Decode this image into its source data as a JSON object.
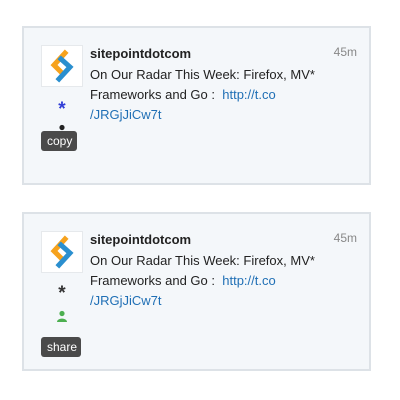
{
  "cards": [
    {
      "username": "sitepointdotcom",
      "timestamp": "45m",
      "text_line1": "On Our Radar This Week: Firefox, MV*",
      "text_line2_prefix": "Frameworks and Go :",
      "link_part1": "http://t.co",
      "link_part2": "/JRGjJiCw7t",
      "fav_glyph": "*",
      "action_label": "copy",
      "fav_color": "#2f3cd6"
    },
    {
      "username": "sitepointdotcom",
      "timestamp": "45m",
      "text_line1": "On Our Radar This Week: Firefox, MV*",
      "text_line2_prefix": "Frameworks and Go :",
      "link_part1": "http://t.co",
      "link_part2": "/JRGjJiCw7t",
      "fav_glyph": "*",
      "action_label": "share",
      "fav_color": "#333333"
    }
  ],
  "colors": {
    "link": "#1f6fb5",
    "card_background": "#f4f7fa",
    "card_border": "#dde2e7",
    "button_background": "#4a4a4a",
    "follow_icon_card1": "#222222",
    "follow_icon_card2": "#4caf50",
    "logo_orange": "#f6a21d",
    "logo_blue": "#2a8fcf"
  },
  "icons": {
    "avatar": "sitepoint-logo-icon",
    "favorite": "asterisk-star-icon",
    "follow": "person-icon"
  }
}
